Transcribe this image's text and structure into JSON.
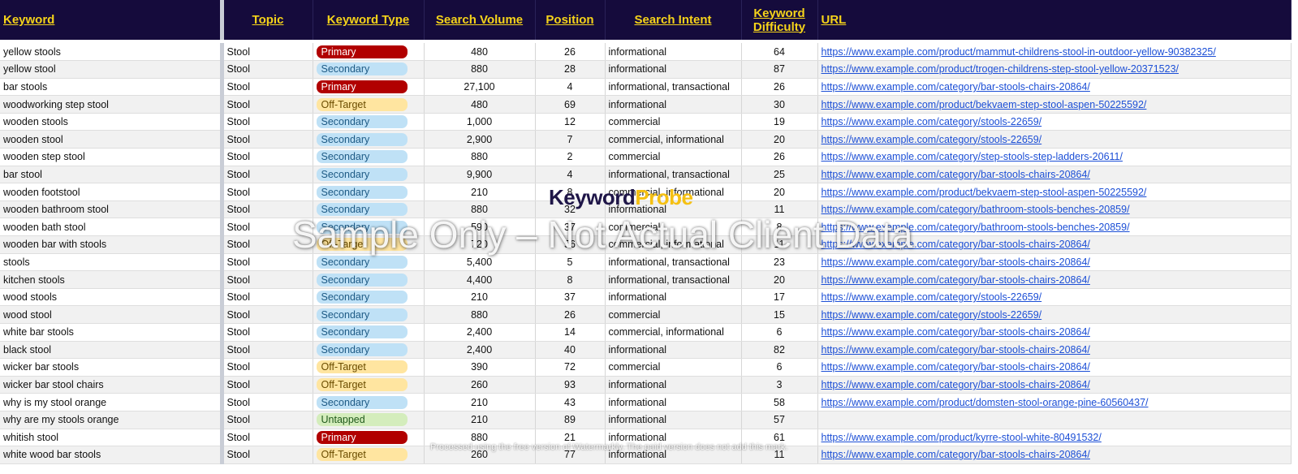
{
  "headers": {
    "keyword": "Keyword",
    "topic": "Topic",
    "type": "Keyword Type",
    "volume": "Search Volume",
    "position": "Position",
    "intent": "Search Intent",
    "difficulty_line1": "Keyword",
    "difficulty_line2": "Difficulty",
    "url": "URL"
  },
  "type_colors": {
    "Primary": "#b10000",
    "Secondary": "#bfe1f6",
    "Off-Target": "#ffe5a0",
    "Untapped": "#d4edbc"
  },
  "rows": [
    {
      "keyword": "yellow stools",
      "topic": "Stool",
      "type": "Primary",
      "volume": "480",
      "position": "26",
      "intent": "informational",
      "difficulty": "64",
      "url": "https://www.example.com/product/mammut-childrens-stool-in-outdoor-yellow-90382325/"
    },
    {
      "keyword": "yellow stool",
      "topic": "Stool",
      "type": "Secondary",
      "volume": "880",
      "position": "28",
      "intent": "informational",
      "difficulty": "87",
      "url": "https://www.example.com/product/trogen-childrens-step-stool-yellow-20371523/"
    },
    {
      "keyword": "bar stools",
      "topic": "Stool",
      "type": "Primary",
      "volume": "27,100",
      "position": "4",
      "intent": "informational, transactional",
      "difficulty": "26",
      "url": "https://www.example.com/category/bar-stools-chairs-20864/"
    },
    {
      "keyword": "woodworking step stool",
      "topic": "Stool",
      "type": "Off-Target",
      "volume": "480",
      "position": "69",
      "intent": "informational",
      "difficulty": "30",
      "url": "https://www.example.com/product/bekvaem-step-stool-aspen-50225592/"
    },
    {
      "keyword": "wooden stools",
      "topic": "Stool",
      "type": "Secondary",
      "volume": "1,000",
      "position": "12",
      "intent": "commercial",
      "difficulty": "19",
      "url": "https://www.example.com/category/stools-22659/"
    },
    {
      "keyword": "wooden stool",
      "topic": "Stool",
      "type": "Secondary",
      "volume": "2,900",
      "position": "7",
      "intent": "commercial, informational",
      "difficulty": "20",
      "url": "https://www.example.com/category/stools-22659/"
    },
    {
      "keyword": "wooden step stool",
      "topic": "Stool",
      "type": "Secondary",
      "volume": "880",
      "position": "2",
      "intent": "commercial",
      "difficulty": "26",
      "url": "https://www.example.com/category/step-stools-step-ladders-20611/"
    },
    {
      "keyword": "bar stool",
      "topic": "Stool",
      "type": "Secondary",
      "volume": "9,900",
      "position": "4",
      "intent": "informational, transactional",
      "difficulty": "25",
      "url": "https://www.example.com/category/bar-stools-chairs-20864/"
    },
    {
      "keyword": "wooden footstool",
      "topic": "Stool",
      "type": "Secondary",
      "volume": "210",
      "position": "8",
      "intent": "commercial, informational",
      "difficulty": "20",
      "url": "https://www.example.com/product/bekvaem-step-stool-aspen-50225592/"
    },
    {
      "keyword": "wooden bathroom stool",
      "topic": "Stool",
      "type": "Secondary",
      "volume": "880",
      "position": "32",
      "intent": "informational",
      "difficulty": "11",
      "url": "https://www.example.com/category/bathroom-stools-benches-20859/"
    },
    {
      "keyword": "wooden bath stool",
      "topic": "Stool",
      "type": "Secondary",
      "volume": "590",
      "position": "37",
      "intent": "commercial",
      "difficulty": "8",
      "url": "https://www.example.com/category/bathroom-stools-benches-20859/"
    },
    {
      "keyword": "wooden bar with stools",
      "topic": "Stool",
      "type": "Off-Target",
      "volume": "720",
      "position": "56",
      "intent": "commercial, informational",
      "difficulty": "11",
      "url": "https://www.example.com/category/bar-stools-chairs-20864/"
    },
    {
      "keyword": "stools",
      "topic": "Stool",
      "type": "Secondary",
      "volume": "5,400",
      "position": "5",
      "intent": "informational, transactional",
      "difficulty": "23",
      "url": "https://www.example.com/category/bar-stools-chairs-20864/"
    },
    {
      "keyword": "kitchen stools",
      "topic": "Stool",
      "type": "Secondary",
      "volume": "4,400",
      "position": "8",
      "intent": "informational, transactional",
      "difficulty": "20",
      "url": "https://www.example.com/category/bar-stools-chairs-20864/"
    },
    {
      "keyword": "wood stools",
      "topic": "Stool",
      "type": "Secondary",
      "volume": "210",
      "position": "37",
      "intent": "informational",
      "difficulty": "17",
      "url": "https://www.example.com/category/stools-22659/"
    },
    {
      "keyword": "wood stool",
      "topic": "Stool",
      "type": "Secondary",
      "volume": "880",
      "position": "26",
      "intent": "commercial",
      "difficulty": "15",
      "url": "https://www.example.com/category/stools-22659/"
    },
    {
      "keyword": "white bar stools",
      "topic": "Stool",
      "type": "Secondary",
      "volume": "2,400",
      "position": "14",
      "intent": "commercial, informational",
      "difficulty": "6",
      "url": "https://www.example.com/category/bar-stools-chairs-20864/"
    },
    {
      "keyword": "black stool",
      "topic": "Stool",
      "type": "Secondary",
      "volume": "2,400",
      "position": "40",
      "intent": "informational",
      "difficulty": "82",
      "url": "https://www.example.com/category/bar-stools-chairs-20864/"
    },
    {
      "keyword": "wicker bar stools",
      "topic": "Stool",
      "type": "Off-Target",
      "volume": "390",
      "position": "72",
      "intent": "commercial",
      "difficulty": "6",
      "url": "https://www.example.com/category/bar-stools-chairs-20864/"
    },
    {
      "keyword": "wicker bar stool chairs",
      "topic": "Stool",
      "type": "Off-Target",
      "volume": "260",
      "position": "93",
      "intent": "informational",
      "difficulty": "3",
      "url": "https://www.example.com/category/bar-stools-chairs-20864/"
    },
    {
      "keyword": "why is my stool orange",
      "topic": "Stool",
      "type": "Secondary",
      "volume": "210",
      "position": "43",
      "intent": "informational",
      "difficulty": "58",
      "url": "https://www.example.com/product/domsten-stool-orange-pine-60560437/"
    },
    {
      "keyword": "why are my stools orange",
      "topic": "Stool",
      "type": "Untapped",
      "volume": "210",
      "position": "89",
      "intent": "informational",
      "difficulty": "57",
      "url": ""
    },
    {
      "keyword": "whitish stool",
      "topic": "Stool",
      "type": "Primary",
      "volume": "880",
      "position": "21",
      "intent": "informational",
      "difficulty": "61",
      "url": "https://www.example.com/product/kyrre-stool-white-80491532/"
    },
    {
      "keyword": "white wood bar stools",
      "topic": "Stool",
      "type": "Off-Target",
      "volume": "260",
      "position": "77",
      "intent": "informational",
      "difficulty": "11",
      "url": "https://www.example.com/category/bar-stools-chairs-20864/"
    }
  ],
  "watermark": {
    "logo_part1": "Keyword",
    "logo_part2": "Probe",
    "main": "Sample Only – Not Actual Client Data",
    "footer": "Processed using the free version of Watermarkly. The paid version does not add this mark."
  }
}
